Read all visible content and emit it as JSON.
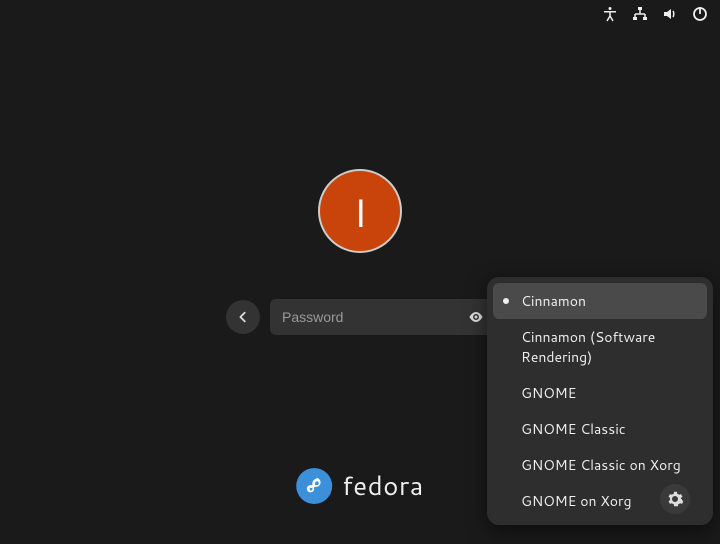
{
  "avatar_initial": "I",
  "username": "",
  "password": {
    "placeholder": "Password",
    "value": ""
  },
  "sessions": [
    {
      "label": "Cinnamon",
      "selected": true
    },
    {
      "label": "Cinnamon (Software Rendering)",
      "selected": false
    },
    {
      "label": "GNOME",
      "selected": false
    },
    {
      "label": "GNOME Classic",
      "selected": false
    },
    {
      "label": "GNOME Classic on Xorg",
      "selected": false
    },
    {
      "label": "GNOME on Xorg",
      "selected": false
    }
  ],
  "brand": "fedora",
  "colors": {
    "avatar_bg": "#c9440a",
    "brand_blue": "#3c8fd9"
  }
}
